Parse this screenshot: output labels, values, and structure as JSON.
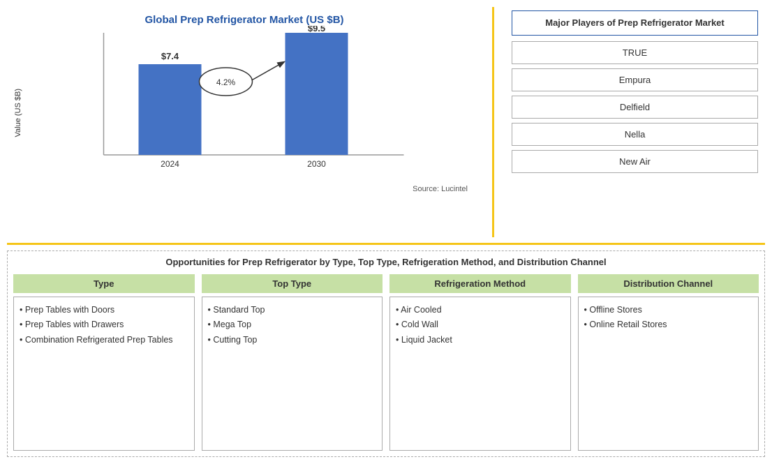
{
  "chart": {
    "title": "Global Prep Refrigerator Market (US $B)",
    "y_axis_label": "Value (US $B)",
    "source": "Source: Lucintel",
    "cagr": "4.2%",
    "bars": [
      {
        "year": "2024",
        "value": "$7.4",
        "height": 130
      },
      {
        "year": "2030",
        "value": "$9.5",
        "height": 185
      }
    ]
  },
  "players": {
    "title": "Major Players of Prep Refrigerator Market",
    "items": [
      "TRUE",
      "Empura",
      "Delfield",
      "Nella",
      "New Air"
    ]
  },
  "opportunities": {
    "title": "Opportunities for Prep Refrigerator by Type, Top Type, Refrigeration Method, and Distribution Channel",
    "categories": [
      {
        "header": "Type",
        "items": [
          "Prep Tables with Doors",
          "Prep Tables with Drawers",
          "Combination Refrigerated Prep Tables"
        ]
      },
      {
        "header": "Top Type",
        "items": [
          "Standard Top",
          "Mega Top",
          "Cutting Top"
        ]
      },
      {
        "header": "Refrigeration Method",
        "items": [
          "Air Cooled",
          "Cold Wall",
          "Liquid Jacket"
        ]
      },
      {
        "header": "Distribution Channel",
        "items": [
          "Offline Stores",
          "Online Retail Stores"
        ]
      }
    ]
  }
}
